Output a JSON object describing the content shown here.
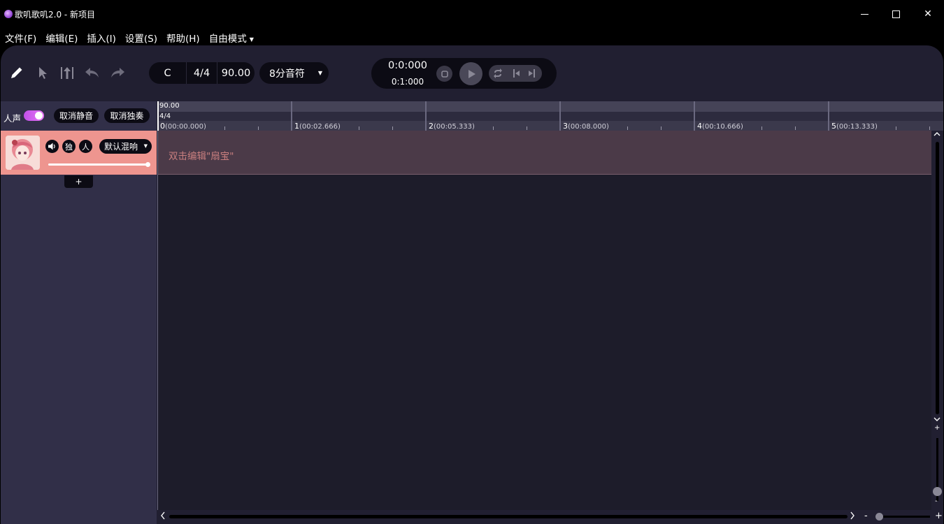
{
  "window": {
    "title": "歌叽歌叽2.0 - 新项目",
    "minimize_glyph": "",
    "close_glyph": "✕"
  },
  "menu": [
    {
      "label": "文件(F)"
    },
    {
      "label": "编辑(E)"
    },
    {
      "label": "插入(I)"
    },
    {
      "label": "设置(S)"
    },
    {
      "label": "帮助(H)"
    },
    {
      "label": "自由模式",
      "caret": "▼"
    }
  ],
  "toolbar": {
    "tools": [
      "pencil-icon",
      "pointer-icon",
      "split-icon",
      "undo-icon",
      "redo-icon"
    ],
    "key": "C",
    "time_signature": "4/4",
    "tempo": "90.00",
    "note_length": "8分音符",
    "note_length_caret": "▼"
  },
  "transport": {
    "current_time": "0:0:000",
    "total_time": "0:1:000"
  },
  "track_panel": {
    "voice_label": "人声",
    "voice_enabled": true,
    "unmute_all_label": "取消静音",
    "unsolo_all_label": "取消独奏",
    "add_track_label": "+"
  },
  "tracks": [
    {
      "solo_label": "独",
      "person_label": "人",
      "mixer_label": "默认混响",
      "mixer_caret": "▼",
      "volume": 1.0,
      "lane_hint": "双击编辑\"扇宝\"",
      "color": "#ee958f"
    }
  ],
  "ruler": {
    "tempo": "90.00",
    "time_signature": "4/4",
    "bars": [
      {
        "num": "0",
        "time": "(00:00.000)"
      },
      {
        "num": "1",
        "time": "(00:02.666)"
      },
      {
        "num": "2",
        "time": "(00:05.333)"
      },
      {
        "num": "3",
        "time": "(00:08.000)"
      },
      {
        "num": "4",
        "time": "(00:10.666)"
      },
      {
        "num": "5",
        "time": "(00:13.333)"
      }
    ]
  },
  "scroll": {
    "vertical_up": "^",
    "vertical_down": "v",
    "zoom_plus": "+",
    "zoom_minus": "-",
    "horizontal_left": "<",
    "horizontal_right": ">",
    "hzoom_minus": "-",
    "hzoom_plus": "+"
  },
  "colors": {
    "background": "#211f31",
    "track_accent": "#ee958f",
    "toggle_accent": "#d060ee",
    "lane_text": "#c97f7f"
  }
}
